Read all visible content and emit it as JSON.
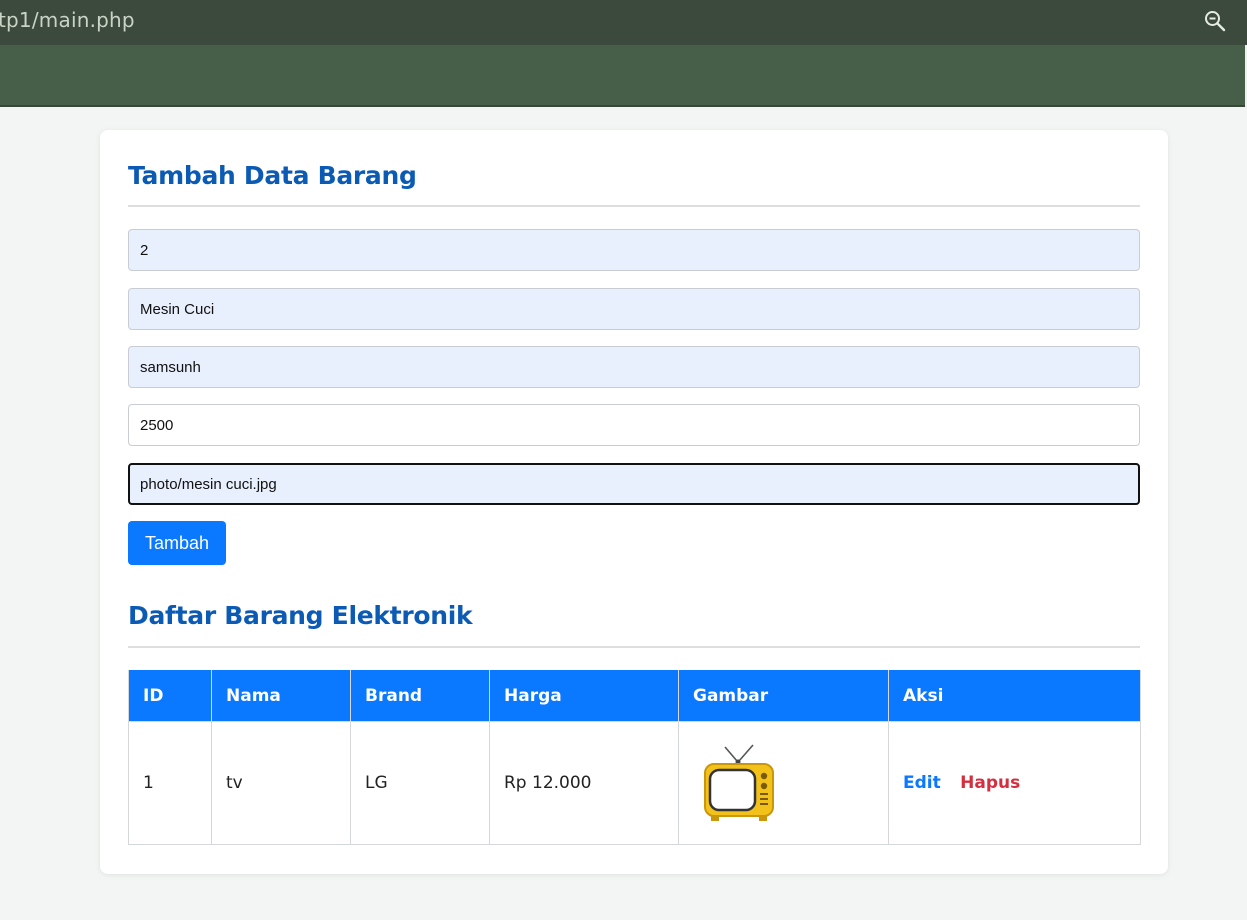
{
  "browser": {
    "url": "tp1/main.php",
    "zoom_icon": "zoom-out-icon"
  },
  "form": {
    "title": "Tambah Data Barang",
    "fields": [
      {
        "name": "id",
        "value": "2"
      },
      {
        "name": "nama",
        "value": "Mesin Cuci"
      },
      {
        "name": "brand",
        "value": "samsunh"
      },
      {
        "name": "harga",
        "value": "2500"
      },
      {
        "name": "gambar",
        "value": "photo/mesin cuci.jpg"
      }
    ],
    "submit_label": "Tambah"
  },
  "list": {
    "title": "Daftar Barang Elektronik",
    "columns": [
      "ID",
      "Nama",
      "Brand",
      "Harga",
      "Gambar",
      "Aksi"
    ],
    "rows": [
      {
        "id": "1",
        "nama": "tv",
        "brand": "LG",
        "harga": "Rp 12.000",
        "gambar": "tv-image",
        "edit": "Edit",
        "hapus": "Hapus"
      }
    ]
  },
  "colors": {
    "accent": "#0a78ff",
    "title": "#0b5ab4",
    "danger": "#d32f3f",
    "browser_bar": "#3b4a3d"
  }
}
